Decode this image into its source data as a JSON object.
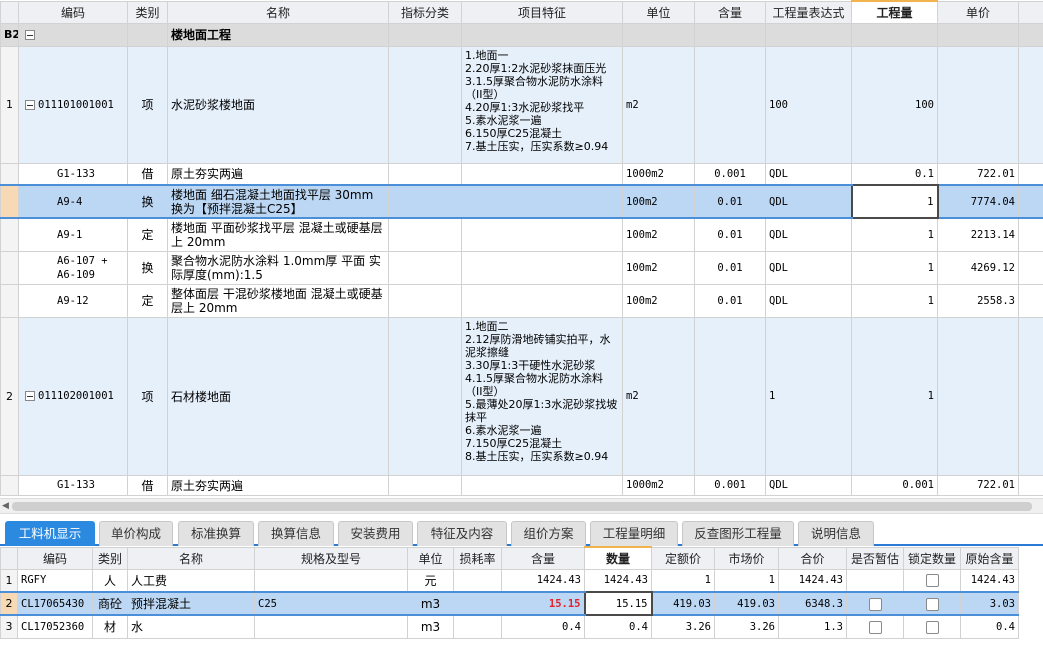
{
  "upper": {
    "headers": [
      "编码",
      "类别",
      "名称",
      "指标分类",
      "项目特征",
      "单位",
      "含量",
      "工程量表达式",
      "工程量",
      "单价"
    ],
    "group": {
      "rn": "B2",
      "name": "楼地面工程"
    },
    "rows": [
      {
        "rn": "1",
        "code": "011101001001",
        "type": "项",
        "name": "水泥砂浆楼地面",
        "feature": "1.地面一\n2.20厚1:2水泥砂浆抹面压光\n3.1.5厚聚合物水泥防水涂料（II型）\n4.20厚1:3水泥砂浆找平\n5.素水泥浆一遍\n6.150厚C25混凝土\n7.基土压实，压实系数≥0.94",
        "unit": "m2",
        "content": "",
        "expr": "100",
        "qty": "100",
        "price": ""
      },
      {
        "rn": "",
        "code": "G1-133",
        "type": "借",
        "name": "原土夯实两遍",
        "feature": "",
        "unit": "1000m2",
        "content": "0.001",
        "expr": "QDL",
        "qty": "0.1",
        "price": "722.01"
      },
      {
        "rn": "",
        "code": "A9-4",
        "type": "换",
        "name": "楼地面 细石混凝土地面找平层 30mm  换为【预拌混凝土C25】",
        "feature": "",
        "unit": "100m2",
        "content": "0.01",
        "expr": "QDL",
        "qty": "1",
        "price": "7774.04"
      },
      {
        "rn": "",
        "code": "A9-1",
        "type": "定",
        "name": "楼地面 平面砂浆找平层 混凝土或硬基层上 20mm",
        "feature": "",
        "unit": "100m2",
        "content": "0.01",
        "expr": "QDL",
        "qty": "1",
        "price": "2213.14"
      },
      {
        "rn": "",
        "code": "A6-107 + A6-109",
        "type": "换",
        "name": "聚合物水泥防水涂料 1.0mm厚 平面  实际厚度(mm):1.5",
        "feature": "",
        "unit": "100m2",
        "content": "0.01",
        "expr": "QDL",
        "qty": "1",
        "price": "4269.12"
      },
      {
        "rn": "",
        "code": "A9-12",
        "type": "定",
        "name": "整体面层 干混砂浆楼地面 混凝土或硬基层上 20mm",
        "feature": "",
        "unit": "100m2",
        "content": "0.01",
        "expr": "QDL",
        "qty": "1",
        "price": "2558.3"
      },
      {
        "rn": "2",
        "code": "011102001001",
        "type": "项",
        "name": "石材楼地面",
        "feature": "1.地面二\n2.12厚防滑地砖铺实拍平，水泥浆擦缝\n3.30厚1:3干硬性水泥砂浆\n4.1.5厚聚合物水泥防水涂料（II型）\n5.最薄处20厚1:3水泥砂浆找坡抹平\n6.素水泥浆一遍\n7.150厚C25混凝土\n8.基土压实，压实系数≥0.94",
        "unit": "m2",
        "content": "",
        "expr": "1",
        "qty": "1",
        "price": ""
      },
      {
        "rn": "",
        "code": "G1-133",
        "type": "借",
        "name": "原土夯实两遍",
        "feature": "",
        "unit": "1000m2",
        "content": "0.001",
        "expr": "QDL",
        "qty": "0.001",
        "price": "722.01"
      }
    ]
  },
  "tabs": [
    "工料机显示",
    "单价构成",
    "标准换算",
    "换算信息",
    "安装费用",
    "特征及内容",
    "组价方案",
    "工程量明细",
    "反查图形工程量",
    "说明信息"
  ],
  "lower": {
    "headers": [
      "编码",
      "类别",
      "名称",
      "规格及型号",
      "单位",
      "损耗率",
      "含量",
      "数量",
      "定额价",
      "市场价",
      "合价",
      "是否暂估",
      "锁定数量",
      "原始含量"
    ],
    "rows": [
      {
        "rn": "1",
        "code": "RGFY",
        "type": "人",
        "name": "人工费",
        "spec": "",
        "unit": "元",
        "loss": "",
        "content": "1424.43",
        "qty": "1424.43",
        "quota": "1",
        "market": "1",
        "total": "1424.43",
        "orig": "1424.43"
      },
      {
        "rn": "2",
        "code": "CL17065430",
        "type": "商砼",
        "name": "预拌混凝土",
        "spec": "C25",
        "unit": "m3",
        "loss": "",
        "content": "15.15",
        "qty": "15.15",
        "quota": "419.03",
        "market": "419.03",
        "total": "6348.3",
        "orig": "3.03"
      },
      {
        "rn": "3",
        "code": "CL17052360",
        "type": "材",
        "name": "水",
        "spec": "",
        "unit": "m3",
        "loss": "",
        "content": "0.4",
        "qty": "0.4",
        "quota": "3.26",
        "market": "3.26",
        "total": "1.3",
        "orig": "0.4"
      }
    ]
  },
  "colors": {
    "accent": "#2b8ae0",
    "selected": "#bcd7f4",
    "highlight": "#e0242b"
  }
}
